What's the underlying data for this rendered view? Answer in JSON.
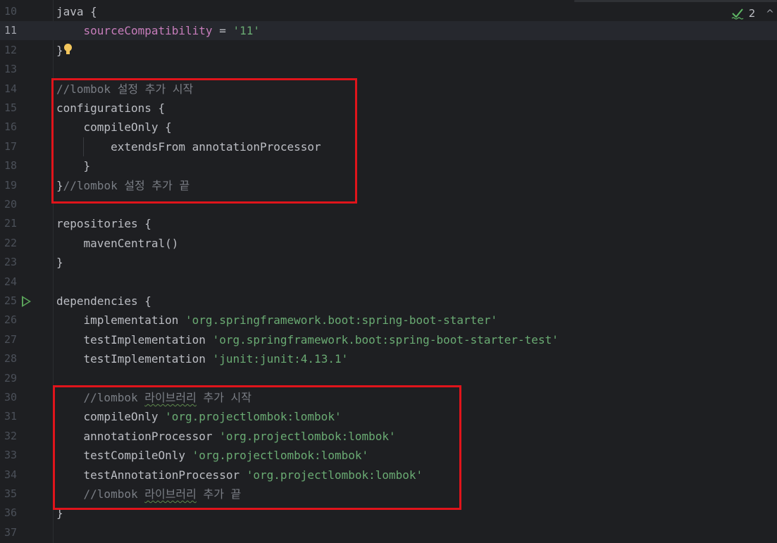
{
  "colors": {
    "background": "#1e1f22",
    "current_line": "#26282e",
    "string": "#6aab73",
    "property": "#c77dbb",
    "comment": "#7a7e85",
    "plain": "#bcbec4",
    "highlight_box": "#e0141b"
  },
  "inspection": {
    "icon": "check-icon",
    "count": "2",
    "chevron": "^"
  },
  "lines": [
    {
      "n": "10",
      "code": [
        {
          "t": "java {",
          "c": "plain"
        }
      ]
    },
    {
      "n": "11",
      "current": true,
      "code": [
        {
          "t": "    ",
          "c": "plain"
        },
        {
          "t": "sourceCompatibility",
          "c": "prop"
        },
        {
          "t": " = ",
          "c": "plain"
        },
        {
          "t": "'11'",
          "c": "str"
        }
      ]
    },
    {
      "n": "12",
      "code": [
        {
          "t": "}",
          "c": "plain"
        }
      ],
      "bulb": true
    },
    {
      "n": "13",
      "code": []
    },
    {
      "n": "14",
      "code": [
        {
          "t": "//lombok 설정 추가 시작",
          "c": "comment"
        }
      ]
    },
    {
      "n": "15",
      "code": [
        {
          "t": "configurations {",
          "c": "plain"
        }
      ]
    },
    {
      "n": "16",
      "code": [
        {
          "t": "    compileOnly {",
          "c": "plain"
        }
      ]
    },
    {
      "n": "17",
      "code": [
        {
          "t": "        extendsFrom annotationProcessor",
          "c": "plain"
        }
      ]
    },
    {
      "n": "18",
      "code": [
        {
          "t": "    }",
          "c": "plain"
        }
      ]
    },
    {
      "n": "19",
      "code": [
        {
          "t": "}",
          "c": "plain"
        },
        {
          "t": "//lombok 설정 추가 끝",
          "c": "comment"
        }
      ]
    },
    {
      "n": "20",
      "code": []
    },
    {
      "n": "21",
      "code": [
        {
          "t": "repositories {",
          "c": "plain"
        }
      ]
    },
    {
      "n": "22",
      "code": [
        {
          "t": "    mavenCentral()",
          "c": "plain"
        }
      ]
    },
    {
      "n": "23",
      "code": [
        {
          "t": "}",
          "c": "plain"
        }
      ]
    },
    {
      "n": "24",
      "code": []
    },
    {
      "n": "25",
      "run": true,
      "code": [
        {
          "t": "dependencies {",
          "c": "plain"
        }
      ]
    },
    {
      "n": "26",
      "code": [
        {
          "t": "    implementation ",
          "c": "plain"
        },
        {
          "t": "'org.springframework.boot:spring-boot-starter'",
          "c": "str"
        }
      ]
    },
    {
      "n": "27",
      "code": [
        {
          "t": "    testImplementation ",
          "c": "plain"
        },
        {
          "t": "'org.springframework.boot:spring-boot-starter-test'",
          "c": "str"
        }
      ]
    },
    {
      "n": "28",
      "code": [
        {
          "t": "    testImplementation ",
          "c": "plain"
        },
        {
          "t": "'junit:junit:4.13.1'",
          "c": "str"
        }
      ]
    },
    {
      "n": "29",
      "code": []
    },
    {
      "n": "30",
      "code": [
        {
          "t": "    //lombok ",
          "c": "comment"
        },
        {
          "t": "라이브러리",
          "c": "comment typo"
        },
        {
          "t": " 추가 시작",
          "c": "comment"
        }
      ]
    },
    {
      "n": "31",
      "code": [
        {
          "t": "    compileOnly ",
          "c": "plain"
        },
        {
          "t": "'org.projectlombok:lombok'",
          "c": "str"
        }
      ]
    },
    {
      "n": "32",
      "code": [
        {
          "t": "    annotationProcessor ",
          "c": "plain"
        },
        {
          "t": "'org.projectlombok:lombok'",
          "c": "str"
        }
      ]
    },
    {
      "n": "33",
      "code": [
        {
          "t": "    testCompileOnly ",
          "c": "plain"
        },
        {
          "t": "'org.projectlombok:lombok'",
          "c": "str"
        }
      ]
    },
    {
      "n": "34",
      "code": [
        {
          "t": "    testAnnotationProcessor ",
          "c": "plain"
        },
        {
          "t": "'org.projectlombok:lombok'",
          "c": "str"
        }
      ]
    },
    {
      "n": "35",
      "code": [
        {
          "t": "    //lombok ",
          "c": "comment"
        },
        {
          "t": "라이브러리",
          "c": "comment typo"
        },
        {
          "t": " 추가 끝",
          "c": "comment"
        }
      ]
    },
    {
      "n": "36",
      "code": [
        {
          "t": "}",
          "c": "plain"
        }
      ]
    },
    {
      "n": "37",
      "code": []
    }
  ]
}
